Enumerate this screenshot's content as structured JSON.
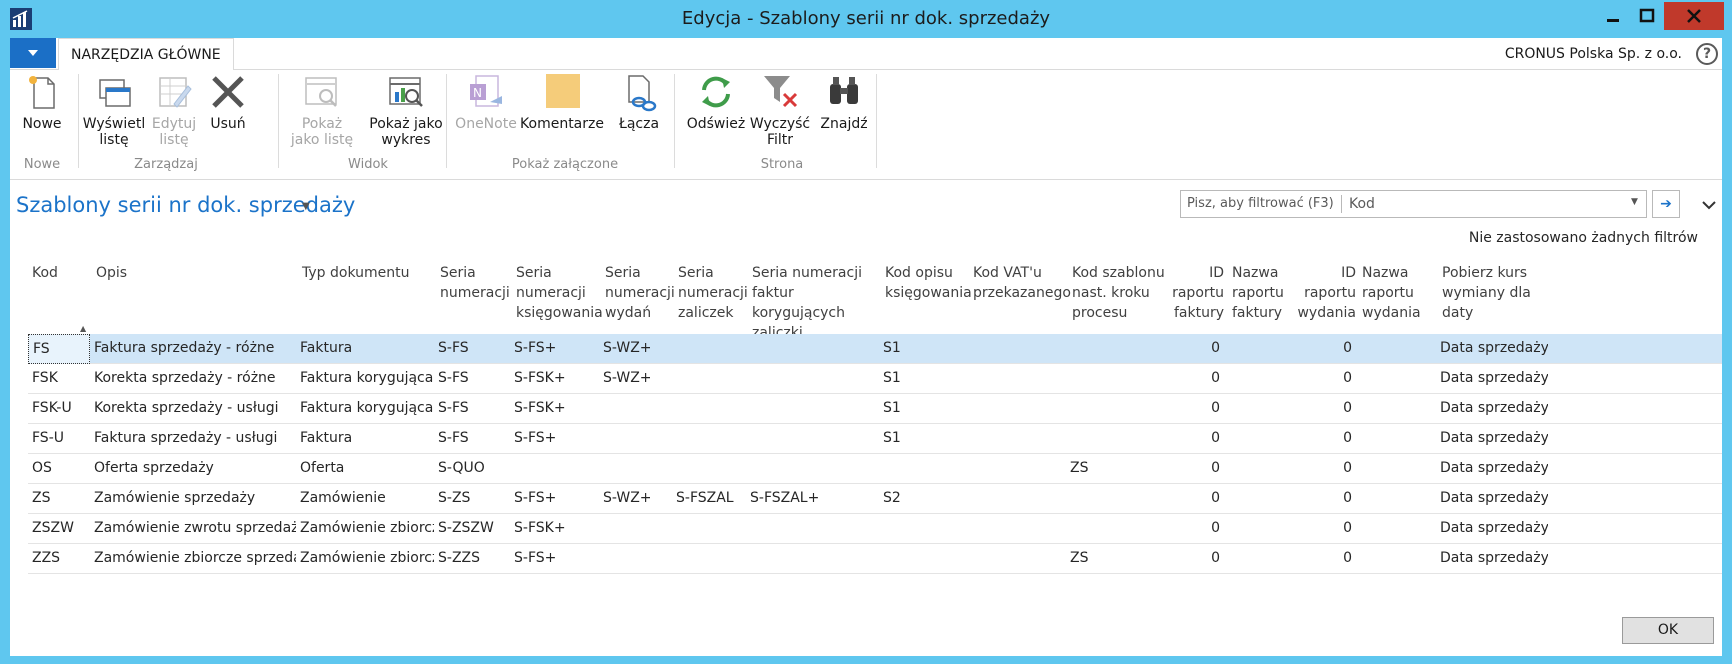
{
  "window": {
    "title": "Edycja - Szablony serii nr dok. sprzedaży"
  },
  "ribbon": {
    "tab_main": "NARZĘDZIA GŁÓWNE",
    "company": "CRONUS Polska Sp. z o.o.",
    "help": "?",
    "groups": [
      {
        "label": "Nowe",
        "buttons": [
          {
            "label1": "Nowe",
            "label2": "",
            "icon": "new-document-icon",
            "disabled": false
          }
        ]
      },
      {
        "label": "Zarządzaj",
        "buttons": [
          {
            "label1": "Wyświetl",
            "label2": "listę",
            "icon": "view-list-icon",
            "disabled": false
          },
          {
            "label1": "Edytuj",
            "label2": "listę",
            "icon": "edit-list-icon",
            "disabled": true
          },
          {
            "label1": "Usuń",
            "label2": "",
            "icon": "delete-icon",
            "disabled": false
          }
        ]
      },
      {
        "label": "Widok",
        "buttons": [
          {
            "label1": "Pokaż",
            "label2": "jako listę",
            "icon": "show-as-list-icon",
            "disabled": true
          },
          {
            "label1": "Pokaż jako",
            "label2": "wykres",
            "icon": "show-as-chart-icon",
            "disabled": false
          }
        ]
      },
      {
        "label": "Pokaż załączone",
        "buttons": [
          {
            "label1": "OneNote",
            "label2": "",
            "icon": "onenote-icon",
            "disabled": true
          },
          {
            "label1": "Komentarze",
            "label2": "",
            "icon": "comments-icon",
            "disabled": false
          },
          {
            "label1": "Łącza",
            "label2": "",
            "icon": "links-icon",
            "disabled": false
          }
        ]
      },
      {
        "label": "Strona",
        "buttons": [
          {
            "label1": "Odśwież",
            "label2": "",
            "icon": "refresh-icon",
            "disabled": false
          },
          {
            "label1": "Wyczyść",
            "label2": "Filtr",
            "icon": "clear-filter-icon",
            "disabled": false
          },
          {
            "label1": "Znajdź",
            "label2": "",
            "icon": "find-icon",
            "disabled": false
          }
        ]
      }
    ]
  },
  "page": {
    "title": "Szablony serii nr dok. sprzedaży",
    "filter_placeholder": "Pisz, aby filtrować (F3)",
    "filter_field": "Kod",
    "no_filters": "Nie zastosowano żadnych filtrów",
    "ok_label": "OK"
  },
  "table": {
    "columns": [
      [
        "Kod"
      ],
      [
        "Opis"
      ],
      [
        "Typ dokumentu"
      ],
      [
        "Seria",
        "numeracji"
      ],
      [
        "Seria",
        "numeracji",
        "księgowania"
      ],
      [
        "Seria",
        "numeracji",
        "wydań"
      ],
      [
        "Seria",
        "numeracji",
        "zaliczek"
      ],
      [
        "Seria numeracji",
        "faktur korygujących",
        "zaliczki"
      ],
      [
        "Kod opisu",
        "księgowania"
      ],
      [
        "Kod VAT'u",
        "przekazanego"
      ],
      [
        "Kod szablonu",
        "nast. kroku",
        "procesu"
      ],
      [
        "ID",
        "raportu",
        "faktury"
      ],
      [
        "Nazwa",
        "raportu",
        "faktury"
      ],
      [
        "ID",
        "raportu",
        "wydania"
      ],
      [
        "Nazwa",
        "raportu",
        "wydania"
      ],
      [
        "Pobierz kurs",
        "wymiany dla daty"
      ]
    ],
    "rows": [
      [
        "FS",
        "Faktura sprzedaży - różne",
        "Faktura",
        "S-FS",
        "S-FS+",
        "S-WZ+",
        "",
        "",
        "S1",
        "",
        "",
        "0",
        "",
        "0",
        "",
        "Data sprzedaży"
      ],
      [
        "FSK",
        "Korekta sprzedaży - różne",
        "Faktura korygująca",
        "S-FS",
        "S-FSK+",
        "S-WZ+",
        "",
        "",
        "S1",
        "",
        "",
        "0",
        "",
        "0",
        "",
        "Data sprzedaży"
      ],
      [
        "FSK-U",
        "Korekta sprzedaży - usługi",
        "Faktura korygująca",
        "S-FS",
        "S-FSK+",
        "",
        "",
        "",
        "S1",
        "",
        "",
        "0",
        "",
        "0",
        "",
        "Data sprzedaży"
      ],
      [
        "FS-U",
        "Faktura sprzedaży - usługi",
        "Faktura",
        "S-FS",
        "S-FS+",
        "",
        "",
        "",
        "S1",
        "",
        "",
        "0",
        "",
        "0",
        "",
        "Data sprzedaży"
      ],
      [
        "OS",
        "Oferta sprzedaży",
        "Oferta",
        "S-QUO",
        "",
        "",
        "",
        "",
        "",
        "",
        "ZS",
        "0",
        "",
        "0",
        "",
        "Data sprzedaży"
      ],
      [
        "ZS",
        "Zamówienie sprzedaży",
        "Zamówienie",
        "S-ZS",
        "S-FS+",
        "S-WZ+",
        "S-FSZAL",
        "S-FSZAL+",
        "S2",
        "",
        "",
        "0",
        "",
        "0",
        "",
        "Data sprzedaży"
      ],
      [
        "ZSZW",
        "Zamówienie zwrotu sprzedaży",
        "Zamówienie zbiorcze",
        "S-ZSZW",
        "S-FSK+",
        "",
        "",
        "",
        "",
        "",
        "",
        "0",
        "",
        "0",
        "",
        "Data sprzedaży"
      ],
      [
        "ZZS",
        "Zamówienie zbiorcze sprzedaży",
        "Zamówienie zbiorcze",
        "S-ZZS",
        "S-FS+",
        "",
        "",
        "",
        "",
        "",
        "ZS",
        "0",
        "",
        "0",
        "",
        "Data sprzedaży"
      ]
    ],
    "selected_row": 0
  }
}
